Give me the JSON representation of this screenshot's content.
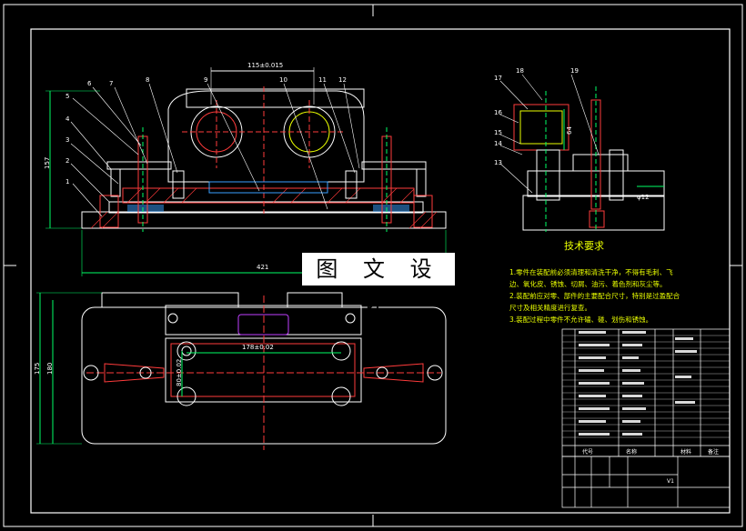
{
  "watermark": "图 文 设 计",
  "dimensions": {
    "top_span": "115±0.015",
    "height_157": "157",
    "overall_421": "421",
    "plan_178": "178±0.02",
    "plan_80": "80±0.02",
    "plan_175": "175",
    "plan_180": "180",
    "side_64": "64",
    "side_112": "φ12"
  },
  "callouts": [
    "1",
    "2",
    "3",
    "4",
    "5",
    "6",
    "7",
    "8",
    "9",
    "10",
    "11",
    "12",
    "13",
    "14",
    "15",
    "16",
    "17",
    "18",
    "19"
  ],
  "tech": {
    "title": "技术要求",
    "lines": [
      "1.零件在装配前必须清理和清洗干净，不得有毛刺、飞",
      "边、氧化皮、锈蚀、切屑、油污、着色剂和灰尘等。",
      "2.装配前应对零、部件的主要配合尺寸，特别是过盈配合",
      "尺寸及相关精度进行复查。",
      "3.装配过程中零件不允许磕、碰、划伤和锈蚀。"
    ]
  },
  "bom_headers": [
    "代号",
    "名称",
    "材料",
    "备注"
  ],
  "title_block_text": "V1"
}
